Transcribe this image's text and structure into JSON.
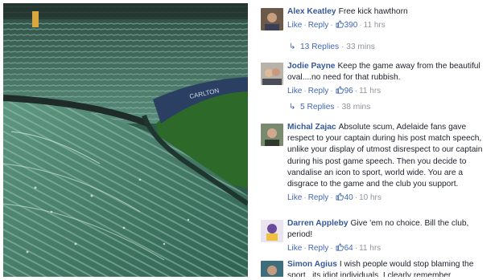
{
  "comments": [
    {
      "name": "Alex Keatley",
      "text": "Free kick hawthorn",
      "like": "Like",
      "reply": "Reply",
      "likes": "390",
      "time": "11 hrs",
      "replies": "13 Replies",
      "replies_time": "33 mins"
    },
    {
      "name": "Jodie Payne",
      "text": "Keep the game away from the beautiful oval....no need for that rubbish.",
      "like": "Like",
      "reply": "Reply",
      "likes": "96",
      "time": "11 hrs",
      "replies": "5 Replies",
      "replies_time": "38 mins"
    },
    {
      "name": "Michal Zajac",
      "text": "Absolute scum, Adelaide fans gave respect to your captain during his post match speech, unlike your display of utmost disrespect to our captain during his post game speech. Then you decide to vandalise an icon to sport, world wide. You are a disgrace to the game and the club you support.",
      "like": "Like",
      "reply": "Reply",
      "likes": "40",
      "time": "10 hrs"
    },
    {
      "name": "Darren Appleby",
      "text": "Give 'em no choice. Bill the club, period!",
      "like": "Like",
      "reply": "Reply",
      "likes": "64",
      "time": "11 hrs"
    },
    {
      "name": "Simon Agius",
      "text": "I wish people would stop blaming the sport.. its idiot individuals. I clearly remember"
    }
  ],
  "colors": {
    "name": "#365899",
    "link": "#4267b2",
    "meta": "#90949c",
    "text": "#1d2129",
    "seats": "#3f7a67",
    "field": "#2d6a2a"
  },
  "icons": {
    "like": "thumbs-up-icon",
    "reply_arrow": "reply-arrow-icon"
  }
}
